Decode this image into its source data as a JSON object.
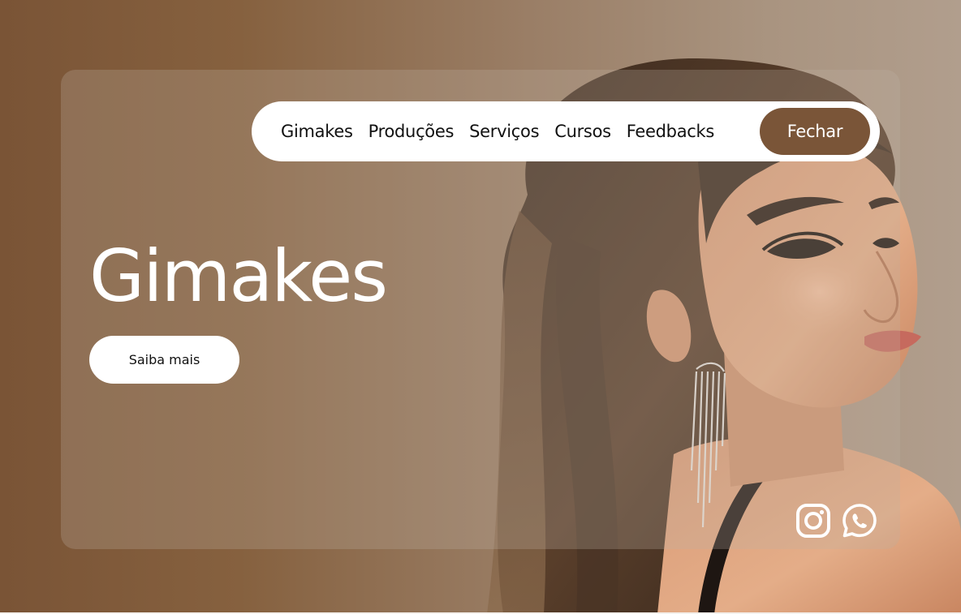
{
  "nav": {
    "items": [
      {
        "label": "Gimakes"
      },
      {
        "label": "Produções"
      },
      {
        "label": "Serviços"
      },
      {
        "label": "Cursos"
      },
      {
        "label": "Feedbacks"
      }
    ],
    "close_label": "Fechar"
  },
  "hero": {
    "title": "Gimakes",
    "cta_label": "Saiba mais"
  },
  "social": {
    "icons": [
      "instagram-icon",
      "whatsapp-icon"
    ]
  },
  "colors": {
    "brand_brown": "#7a5538",
    "white": "#ffffff"
  }
}
